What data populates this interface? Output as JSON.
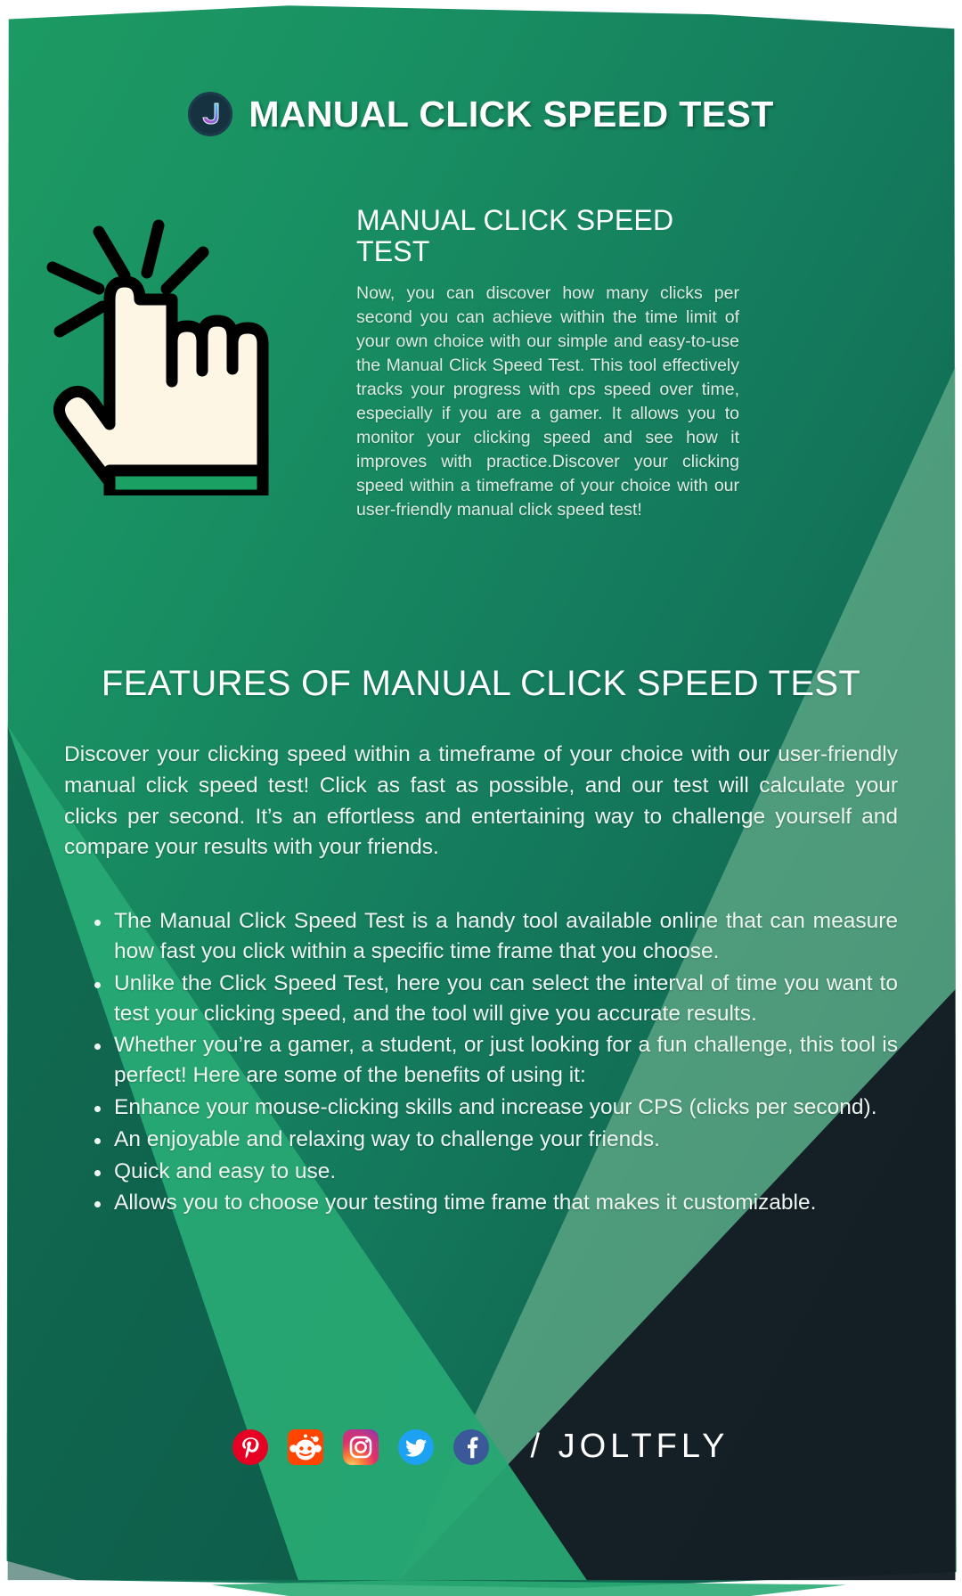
{
  "header": {
    "title": "MANUAL CLICK SPEED TEST",
    "logo_icon": "joltfly-j-logo-icon",
    "logo_letter": "J",
    "logo_circle_color": "#16313f",
    "logo_gradient_from": "#3fd6f0",
    "logo_gradient_to": "#c23fd0"
  },
  "intro": {
    "illustration_icon": "clicking-hand-cursor-icon",
    "heading": "MANUAL CLICK SPEED TEST",
    "body": "Now, you can discover how many clicks per second you can achieve within the time limit of your own choice with our simple and easy-to-use the Manual Click Speed Test. This tool effectively tracks your progress with cps speed over time, especially if you are a gamer. It allows you to monitor your clicking speed and see how it improves with practice.Discover your clicking speed within a timeframe of your choice with our user-friendly manual click speed test!"
  },
  "features": {
    "heading": "FEATURES OF MANUAL CLICK SPEED TEST",
    "intro": "Discover your clicking speed within a timeframe of your choice with our user-friendly manual click speed test!  Click as fast as possible, and our test will calculate your clicks per second. It’s an effortless and entertaining way to challenge yourself and compare your results with your friends.",
    "bullets": [
      "The Manual Click Speed Test is a handy tool available online that can measure how fast you click within a specific time frame that you choose.",
      "Unlike the Click Speed Test, here you can select the interval of time you want to test your clicking speed, and the tool will give you accurate results.",
      "Whether you’re a gamer, a student, or just looking for a fun challenge, this tool is perfect! Here are some of the benefits of using it:",
      "Enhance your mouse-clicking skills and increase your CPS (clicks per second).",
      "An enjoyable and relaxing way to challenge your friends.",
      "Quick and easy to use.",
      "Allows you to choose your testing time frame that makes it customizable."
    ]
  },
  "footer": {
    "socials": [
      {
        "name": "pinterest-icon",
        "label": "Pinterest",
        "color": "#e60023"
      },
      {
        "name": "reddit-icon",
        "label": "Reddit",
        "color": "#ff4500"
      },
      {
        "name": "instagram-icon",
        "label": "Instagram",
        "color": "#d6249f"
      },
      {
        "name": "twitter-icon",
        "label": "Twitter",
        "color": "#1da1f2"
      },
      {
        "name": "facebook-icon",
        "label": "Facebook",
        "color": "#3b5998"
      }
    ],
    "brand": "/ JOLTFLY"
  },
  "theme": {
    "green_dark": "#0c5a49",
    "green_mid": "#199163",
    "green_light": "#27a873",
    "wedge_light": "#74b894",
    "wedge_dark": "#10161f",
    "text_white": "#ffffff"
  }
}
